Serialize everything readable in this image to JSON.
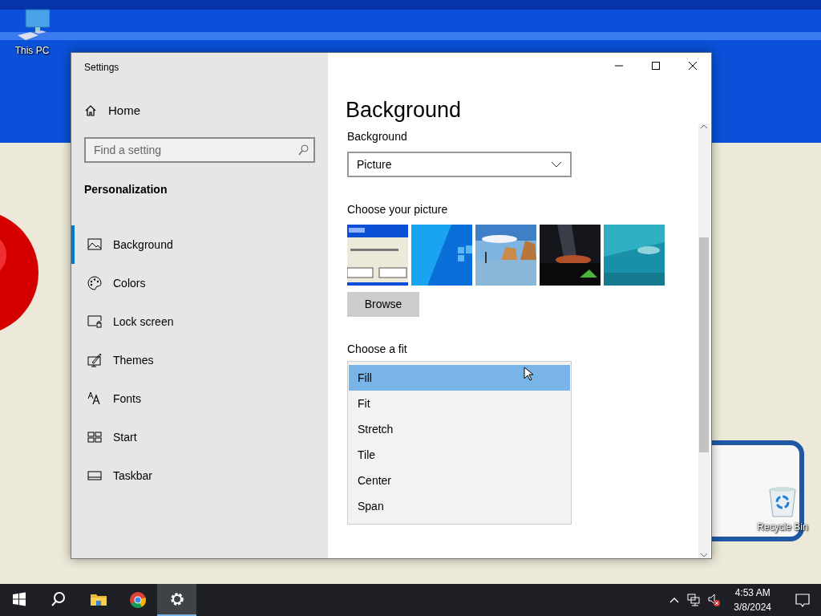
{
  "desktop": {
    "icons": [
      {
        "label": "This PC",
        "kind": "computer"
      },
      {
        "label": "Recycle Bin",
        "kind": "recycle"
      }
    ]
  },
  "window": {
    "title": "Settings",
    "sidebar": {
      "home": "Home",
      "search": {
        "placeholder": "Find a setting"
      },
      "section": "Personalization",
      "items": [
        {
          "label": "Background",
          "kind": "background",
          "selected": true
        },
        {
          "label": "Colors",
          "kind": "colors",
          "selected": false
        },
        {
          "label": "Lock screen",
          "kind": "lock",
          "selected": false
        },
        {
          "label": "Themes",
          "kind": "themes",
          "selected": false
        },
        {
          "label": "Fonts",
          "kind": "fonts",
          "selected": false
        },
        {
          "label": "Start",
          "kind": "start",
          "selected": false
        },
        {
          "label": "Taskbar",
          "kind": "taskbar",
          "selected": false
        }
      ]
    },
    "main": {
      "title": "Background",
      "background_label": "Background",
      "background_value": "Picture",
      "picture_label": "Choose your picture",
      "browse": "Browse",
      "fit_label": "Choose a fit",
      "fit_options": [
        {
          "label": "Fill",
          "selected": true
        },
        {
          "label": "Fit",
          "selected": false
        },
        {
          "label": "Stretch",
          "selected": false
        },
        {
          "label": "Tile",
          "selected": false
        },
        {
          "label": "Center",
          "selected": false
        },
        {
          "label": "Span",
          "selected": false
        }
      ]
    }
  },
  "taskbar": {
    "apps": [
      {
        "kind": "start",
        "active": false
      },
      {
        "kind": "search",
        "active": false
      },
      {
        "kind": "folder",
        "active": false
      },
      {
        "kind": "browser",
        "active": false
      },
      {
        "kind": "settings",
        "active": true
      }
    ],
    "tray": {
      "muted": true,
      "time": "4:53 AM",
      "date": "3/8/2024"
    }
  }
}
